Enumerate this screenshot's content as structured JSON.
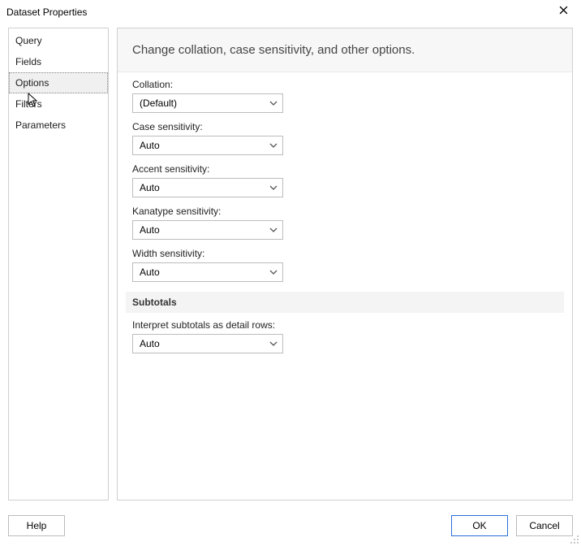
{
  "window": {
    "title": "Dataset Properties"
  },
  "sidebar": {
    "items": [
      {
        "label": "Query"
      },
      {
        "label": "Fields"
      },
      {
        "label": "Options"
      },
      {
        "label": "Filters"
      },
      {
        "label": "Parameters"
      }
    ],
    "selected_index": 2
  },
  "header": {
    "text": "Change collation, case sensitivity, and other options."
  },
  "fields": {
    "collation": {
      "label": "Collation:",
      "value": "(Default)"
    },
    "case_sensitivity": {
      "label": "Case sensitivity:",
      "value": "Auto"
    },
    "accent_sensitivity": {
      "label": "Accent sensitivity:",
      "value": "Auto"
    },
    "kanatype_sensitivity": {
      "label": "Kanatype sensitivity:",
      "value": "Auto"
    },
    "width_sensitivity": {
      "label": "Width sensitivity:",
      "value": "Auto"
    }
  },
  "subtotals": {
    "section_label": "Subtotals",
    "interpret": {
      "label": "Interpret subtotals as detail rows:",
      "value": "Auto"
    }
  },
  "buttons": {
    "help": "Help",
    "ok": "OK",
    "cancel": "Cancel"
  }
}
